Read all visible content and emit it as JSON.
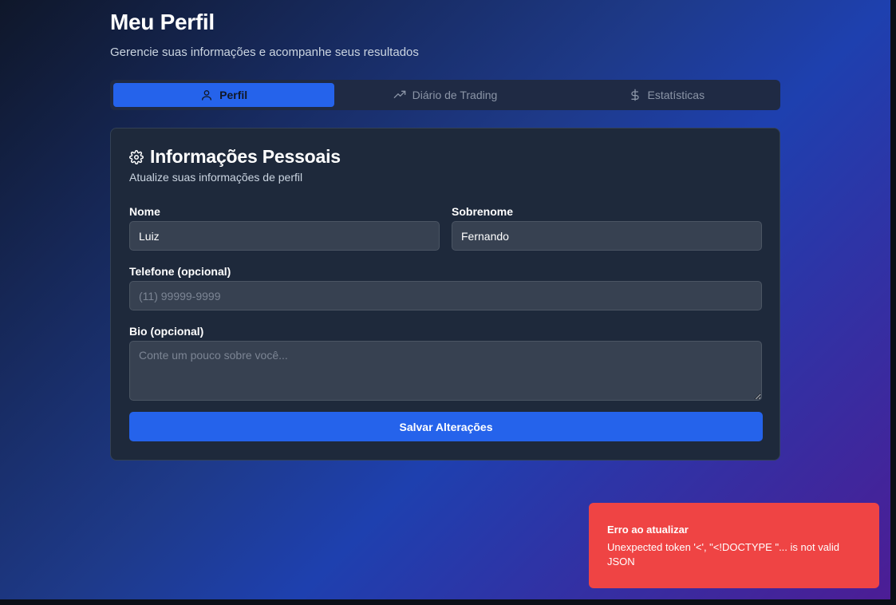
{
  "header": {
    "title": "Meu Perfil",
    "subtitle": "Gerencie suas informações e acompanhe seus resultados"
  },
  "tabs": [
    {
      "label": "Perfil",
      "icon": "user-icon",
      "active": true
    },
    {
      "label": "Diário de Trading",
      "icon": "trending-up-icon",
      "active": false
    },
    {
      "label": "Estatísticas",
      "icon": "dollar-icon",
      "active": false
    }
  ],
  "card": {
    "icon": "gear-icon",
    "title": "Informações Pessoais",
    "description": "Atualize suas informações de perfil"
  },
  "form": {
    "first_name": {
      "label": "Nome",
      "value": "Luiz"
    },
    "last_name": {
      "label": "Sobrenome",
      "value": "Fernando"
    },
    "phone": {
      "label": "Telefone (opcional)",
      "placeholder": "(11) 99999-9999"
    },
    "bio": {
      "label": "Bio (opcional)",
      "placeholder": "Conte um pouco sobre você..."
    },
    "save_label": "Salvar Alterações"
  },
  "toast": {
    "title": "Erro ao atualizar",
    "message": "Unexpected token '<', \"<!DOCTYPE \"... is not valid JSON"
  },
  "colors": {
    "accent": "#2563eb",
    "error": "#ef4444",
    "card_bg": "#1e293b",
    "input_bg": "#374151"
  }
}
